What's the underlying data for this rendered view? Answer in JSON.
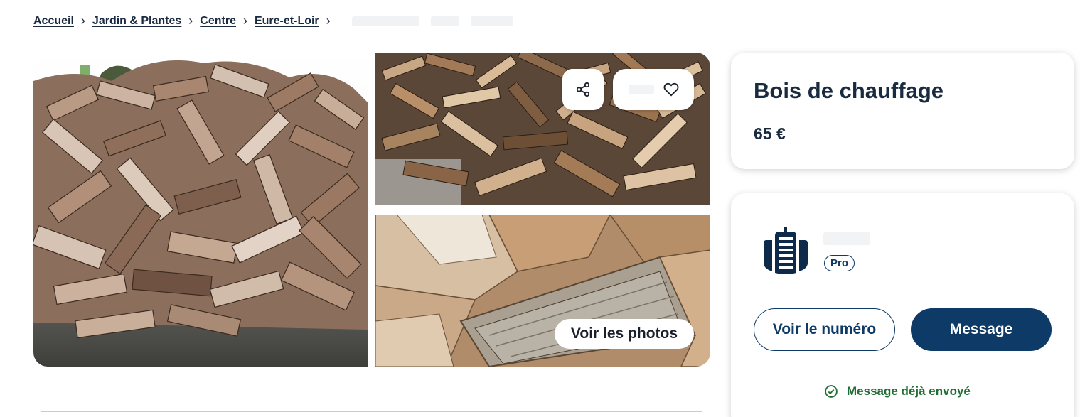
{
  "breadcrumb": {
    "items": [
      "Accueil",
      "Jardin & Plantes",
      "Centre",
      "Eure-et-Loir"
    ]
  },
  "gallery": {
    "see_photos_label": "Voir les photos"
  },
  "ad": {
    "title": "Bois de chauffage",
    "price": "65 €"
  },
  "seller": {
    "badge": "Pro",
    "show_number_label": "Voir le numéro",
    "message_label": "Message",
    "message_sent_label": "Message déjà envoyé"
  },
  "colors": {
    "primary": "#0d3a66",
    "success": "#216e35",
    "text": "#1a2a3f"
  },
  "icons": [
    "share-icon",
    "heart-icon",
    "check-circle-icon",
    "building-icon",
    "chevron-right-icon"
  ]
}
